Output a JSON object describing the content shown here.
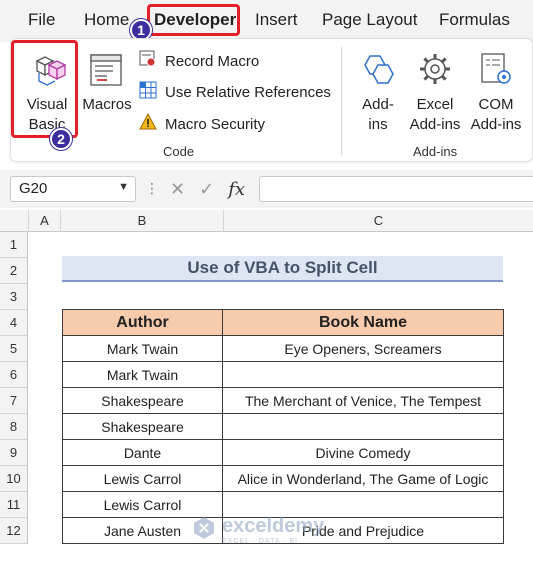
{
  "tabs": [
    "File",
    "Home",
    "Developer",
    "Insert",
    "Page Layout",
    "Formulas"
  ],
  "active_tab": "Developer",
  "annotations": [
    "1",
    "2"
  ],
  "ribbon": {
    "code_group": {
      "visual_basic": [
        "Visual",
        "Basic"
      ],
      "macros": "Macros",
      "record_macro": "Record Macro",
      "use_relative": "Use Relative References",
      "macro_security": "Macro Security",
      "label": "Code"
    },
    "addins_group": {
      "addins": [
        "Add-",
        "ins"
      ],
      "excel_addins": [
        "Excel",
        "Add-ins"
      ],
      "com_addins": [
        "COM",
        "Add-ins"
      ],
      "label": "Add-ins"
    }
  },
  "formula_bar": {
    "name_box": "G20",
    "fx": "fx",
    "value": ""
  },
  "columns": [
    "A",
    "B",
    "C"
  ],
  "rows": [
    "1",
    "2",
    "3",
    "4",
    "5",
    "6",
    "7",
    "8",
    "9",
    "10",
    "11",
    "12"
  ],
  "sheet": {
    "title": "Use of VBA to Split Cell",
    "headers": [
      "Author",
      "Book Name"
    ],
    "rows": [
      [
        "Mark Twain",
        "Eye Openers, Screamers"
      ],
      [
        "Mark Twain",
        ""
      ],
      [
        "Shakespeare",
        "The Merchant of Venice, The Tempest"
      ],
      [
        "Shakespeare",
        ""
      ],
      [
        "Dante",
        "Divine Comedy"
      ],
      [
        "Lewis Carrol",
        "Alice in Wonderland, The Game of Logic"
      ],
      [
        "Lewis Carrol",
        ""
      ],
      [
        "Jane Austen",
        "Pride and Prejudice"
      ]
    ]
  },
  "watermark": {
    "name": "exceldemy",
    "tagline": "EXCEL · DATA · BI"
  },
  "colors": {
    "highlight": "#e3202a",
    "badge": "#3b2fa0",
    "header_fill": "#f8cbad",
    "title_fill": "#dfe6f3",
    "title_text": "#44546a"
  }
}
